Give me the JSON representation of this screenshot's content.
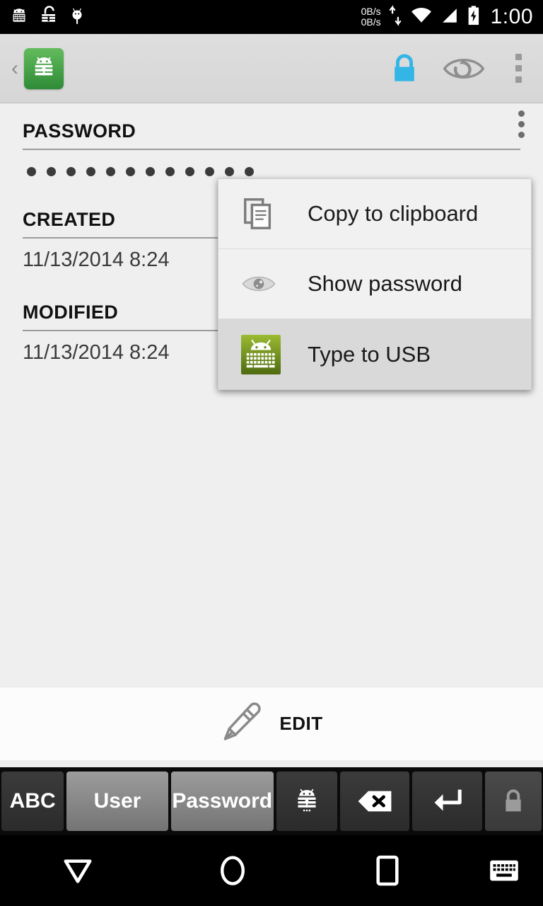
{
  "statusbar": {
    "icons": [
      "keepass-keyboard-icon",
      "unlocked-padlock-icon",
      "debug-bug-icon"
    ],
    "net_speed_up": "0B/s",
    "net_speed_down": "0B/s",
    "traffic_icon": "up-down-arrows-icon",
    "wifi_icon": "wifi-icon",
    "signal_icon": "cellular-signal-icon",
    "battery_icon": "battery-charging-icon",
    "clock": "1:00"
  },
  "actionbar": {
    "back_glyph": "‹",
    "app_icon": "keepass-app-icon",
    "lock_icon": "lock-database-icon",
    "lock_color": "#33b5e5",
    "eye_icon": "toggle-visibility-icon",
    "overflow_icon": "overflow-menu-icon"
  },
  "content": {
    "fields": [
      {
        "label": "PASSWORD",
        "type": "masked",
        "dots": 12,
        "has_overflow": true
      },
      {
        "label": "CREATED",
        "type": "text",
        "value": "11/13/2014 8:24"
      },
      {
        "label": "MODIFIED",
        "type": "text",
        "value": "11/13/2014 8:24"
      }
    ]
  },
  "popup": {
    "items": [
      {
        "label": "Copy to clipboard",
        "icon": "copy-icon",
        "highlighted": false
      },
      {
        "label": "Show password",
        "icon": "eye-icon",
        "highlighted": false
      },
      {
        "label": "Type to USB",
        "icon": "android-keyboard-icon",
        "highlighted": true
      }
    ]
  },
  "editbar": {
    "icon": "pencil-icon",
    "label": "EDIT"
  },
  "keyboard": {
    "keys": [
      {
        "label": "ABC",
        "name": "key-abc",
        "style": "dark"
      },
      {
        "label": "User",
        "name": "key-user",
        "style": "light"
      },
      {
        "label": "Password",
        "name": "key-password",
        "style": "light"
      },
      {
        "label": "",
        "name": "key-keepass-icon",
        "style": "dark"
      },
      {
        "label": "",
        "name": "key-backspace",
        "style": "dark"
      },
      {
        "label": "",
        "name": "key-enter",
        "style": "dark"
      },
      {
        "label": "",
        "name": "key-lock",
        "style": "dark"
      }
    ]
  },
  "navbar": {
    "back_icon": "hide-keyboard-back-icon",
    "home_icon": "home-icon",
    "recents_icon": "recents-icon",
    "keyboard_icon": "keyboard-switch-icon"
  }
}
